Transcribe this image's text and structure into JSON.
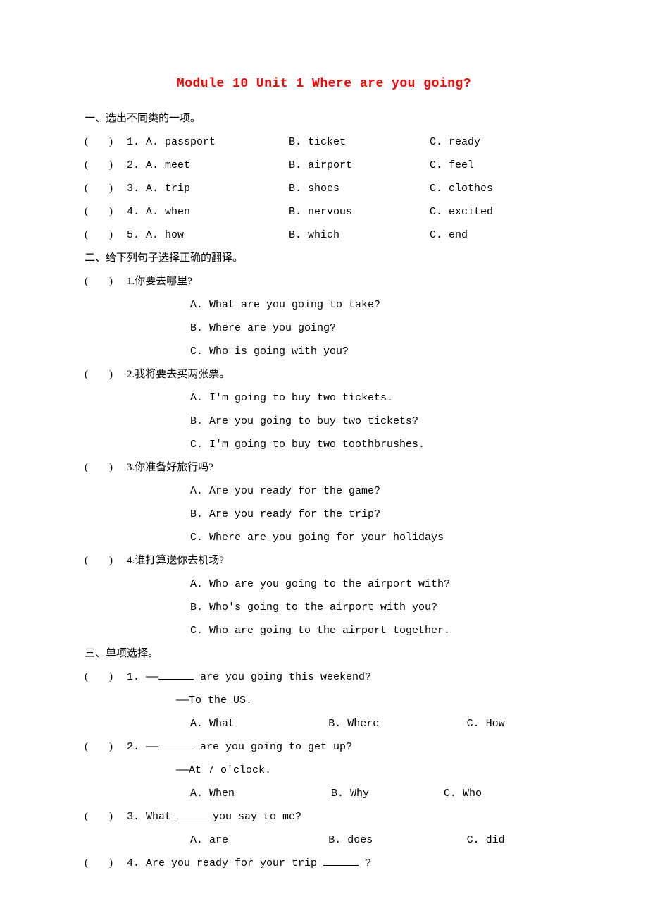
{
  "title": "Module 10 Unit 1 Where are you going?",
  "s1": {
    "head": "一、选出不同类的一项。",
    "rows": [
      {
        "n": "1.",
        "a": "A. passport",
        "b": "B. ticket",
        "c": "C. ready"
      },
      {
        "n": "2.",
        "a": "A. meet",
        "b": "B. airport",
        "c": "C. feel"
      },
      {
        "n": "3.",
        "a": "A. trip",
        "b": "B. shoes",
        "c": "C. clothes"
      },
      {
        "n": "4.",
        "a": "A. when",
        "b": "B. nervous",
        "c": "C. excited"
      },
      {
        "n": "5.",
        "a": "A. how",
        "b": "B. which",
        "c": "C. end"
      }
    ]
  },
  "s2": {
    "head": "二、给下列句子选择正确的翻译。",
    "q1": {
      "stem": "1.你要去哪里?",
      "a": "A. What are you going to take?",
      "b": "B. Where are you going?",
      "c": "C. Who is going with you?"
    },
    "q2": {
      "stem": "2.我将要去买两张票。",
      "a": "A. I'm going to buy two tickets.",
      "b": "B. Are you going to buy two tickets?",
      "c": "C. I'm going to buy two toothbrushes."
    },
    "q3": {
      "stem": "3.你准备好旅行吗?",
      "a": "A. Are you ready for the game?",
      "b": "B. Are you ready for the trip?",
      "c": "C. Where are you going for your holidays"
    },
    "q4": {
      "stem": "4.谁打算送你去机场?",
      "a": "A. Who are you going to the airport with?",
      "b": "B. Who's going to the airport with you?",
      "c": "C. Who are going to the airport together."
    }
  },
  "s3": {
    "head": "三、单项选择。",
    "q1": {
      "pre": "1. ——",
      "post": " are you going this weekend?",
      "ans": "——To the US.",
      "a": "A. What",
      "b": "B. Where",
      "c": "C. How"
    },
    "q2": {
      "pre": "2. ——",
      "post": " are you going to get up?",
      "ans": "——At 7 o'clock.",
      "a": "A. When",
      "b": "B. Why",
      "c": "C. Who"
    },
    "q3": {
      "pre": "3. What ",
      "post": "you say to me?",
      "a": "A. are",
      "b": "B. does",
      "c": "C. did"
    },
    "q4": {
      "pre": "4. Are you ready for your trip ",
      "post": " ?"
    }
  },
  "paren": "(　　)"
}
